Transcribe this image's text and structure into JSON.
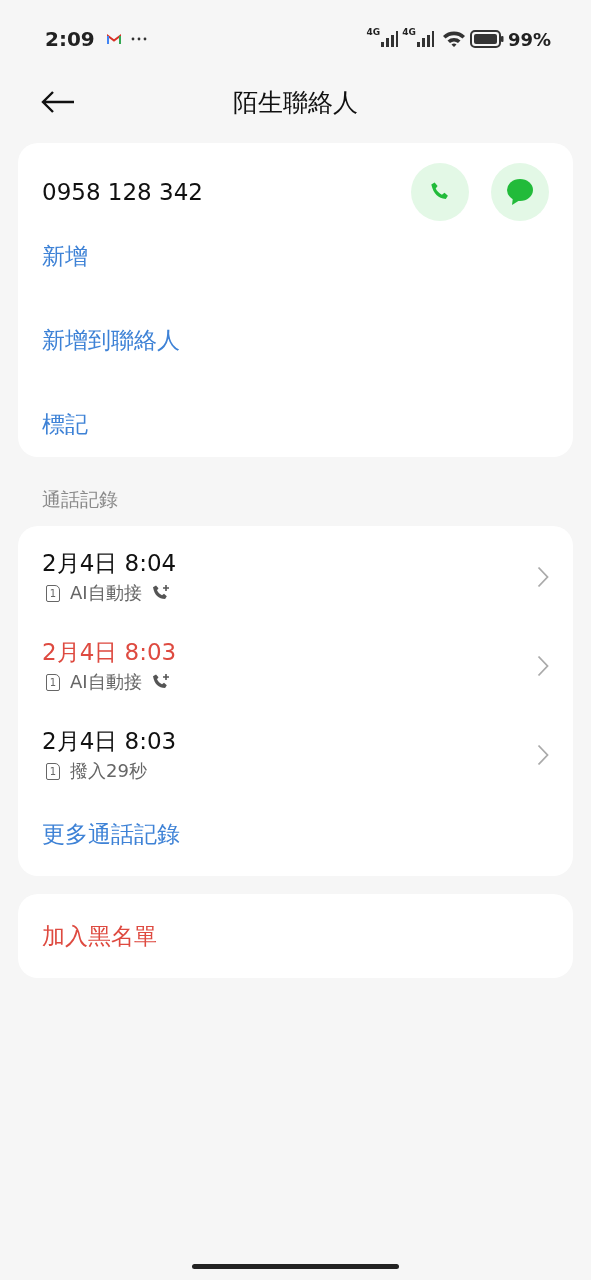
{
  "status_bar": {
    "time": "2:09",
    "battery": "99%",
    "network_1": "4G",
    "network_2": "4G"
  },
  "header": {
    "title": "陌生聯絡人"
  },
  "contact": {
    "number": "0958 128 342",
    "actions": [
      "新增",
      "新增到聯絡人",
      "標記"
    ]
  },
  "call_log": {
    "heading": "通話記錄",
    "calls": [
      {
        "time": "2月4日 8:04",
        "missed": false,
        "sim": "1",
        "detail": "AI自動接",
        "kind": "ai"
      },
      {
        "time": "2月4日 8:03",
        "missed": true,
        "sim": "1",
        "detail": "AI自動接",
        "kind": "ai"
      },
      {
        "time": "2月4日 8:03",
        "missed": false,
        "sim": "1",
        "detail": "撥入29秒",
        "kind": "plain"
      }
    ],
    "more": "更多通話記錄"
  },
  "block": {
    "label": "加入黑名單"
  }
}
